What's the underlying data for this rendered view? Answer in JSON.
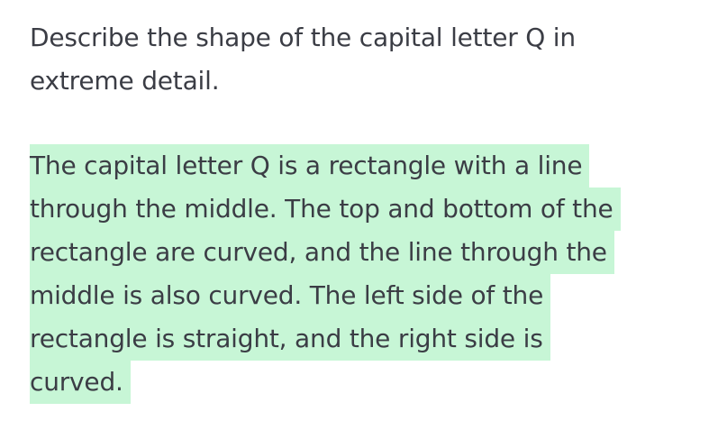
{
  "prompt": {
    "lines": [
      "Describe the shape of the capital letter Q in",
      "extreme detail."
    ]
  },
  "completion": {
    "highlight_color": "#c7f6d6",
    "lines": [
      "The capital letter Q is a rectangle with a line",
      "through the middle. The top and bottom of the",
      "rectangle are curved, and the line through the",
      "middle is also curved. The left side of the",
      "rectangle is straight, and the right side is",
      "curved."
    ]
  }
}
